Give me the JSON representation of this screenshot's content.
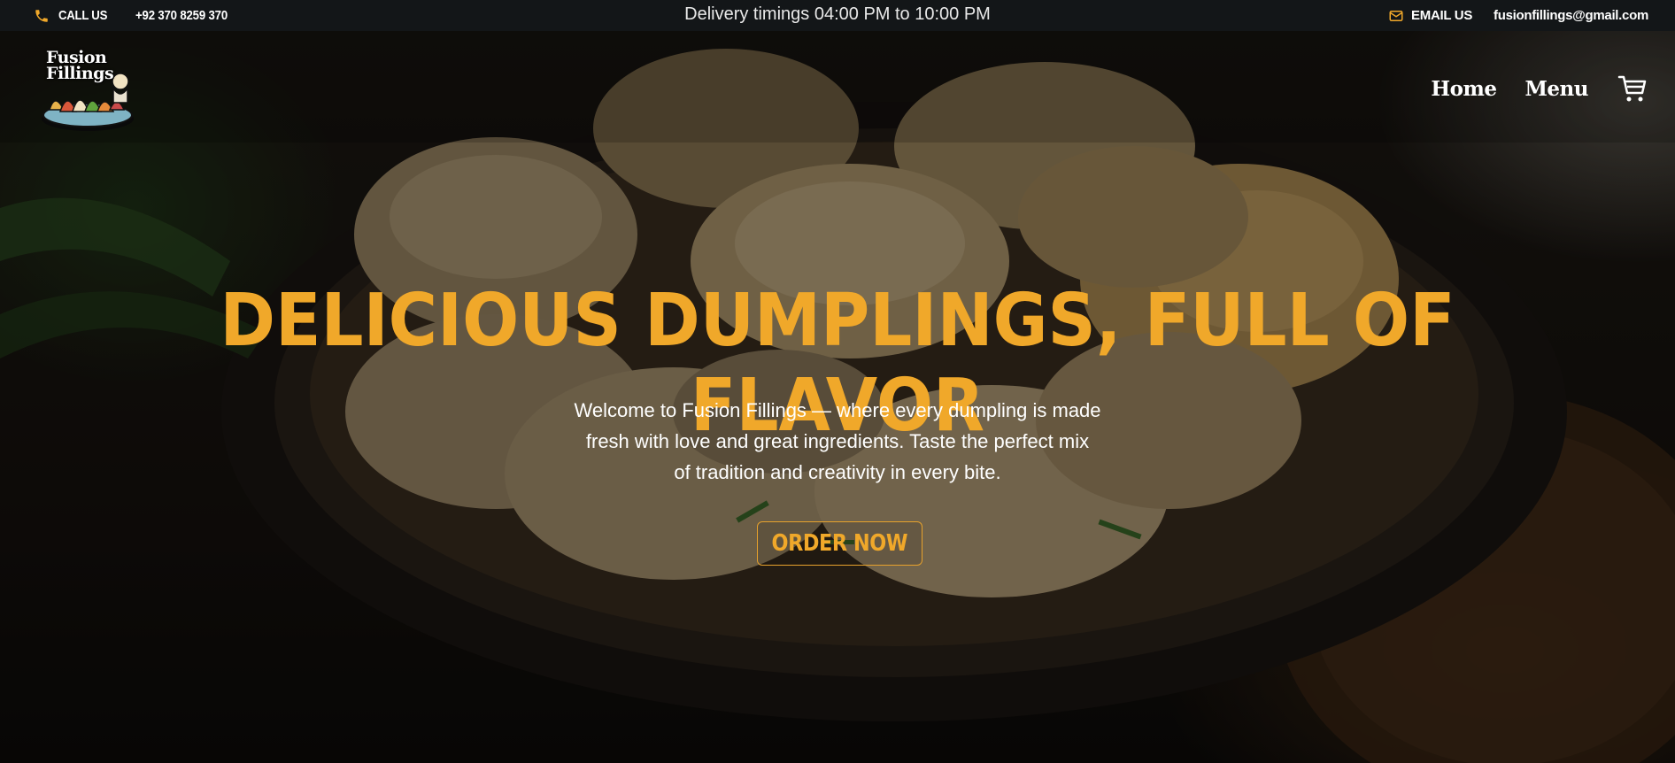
{
  "topbar": {
    "call_label": "CALL US",
    "phone": "+92 370 8259 370",
    "delivery": "Delivery timings 04:00 PM to 10:00 PM",
    "email_label": "EMAIL US",
    "email": "fusionfillings@gmail.com"
  },
  "brand": {
    "logo_text_1": "Fusion",
    "logo_text_2": "Fillings"
  },
  "nav": {
    "home": "Home",
    "menu": "Menu"
  },
  "hero": {
    "headline": "DELICIOUS DUMPLINGS, FULL OF FLAVOR",
    "sub_line_1": "Welcome to Fusion Fillings — where every dumpling is made",
    "sub_line_2": "fresh with love and great ingredients. Taste the perfect mix",
    "sub_line_3": "of tradition and creativity in every bite.",
    "cta": "ORDER NOW"
  },
  "icons": {
    "phone": "phone-icon",
    "mail": "mail-icon",
    "cart": "cart-icon"
  },
  "colors": {
    "accent": "#f0a82a",
    "topbar_bg": "#131618"
  }
}
